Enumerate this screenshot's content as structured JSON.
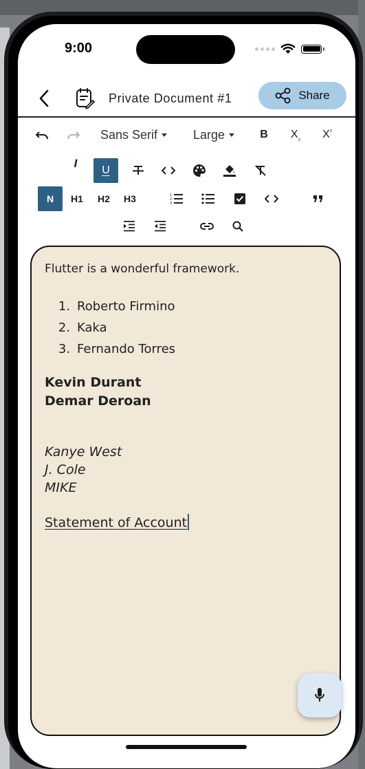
{
  "status_bar": {
    "time": "9:00"
  },
  "app_bar": {
    "title": "Private Document #1",
    "share_label": "Share"
  },
  "toolbar": {
    "font_family": "Sans Serif",
    "font_size": "Large",
    "bold": "B",
    "subscript": "X",
    "subscript_mark": "₂",
    "superscript": "X",
    "superscript_mark": "²",
    "italic": "I",
    "underline": "U",
    "heading_normal": "N",
    "heading_1": "H1",
    "heading_2": "H2",
    "heading_3": "H3",
    "active_buttons": [
      "underline",
      "normal"
    ]
  },
  "editor": {
    "paragraph": "Flutter is a wonderful framework.",
    "ordered_list": [
      {
        "num": "1.",
        "text": "Roberto Firmino"
      },
      {
        "num": "2.",
        "text": "Kaka"
      },
      {
        "num": "3.",
        "text": "Fernando Torres"
      }
    ],
    "bold_lines": [
      "Kevin Durant",
      "Demar Deroan"
    ],
    "italic_lines": [
      "Kanye West",
      "J. Cole",
      "MIKE"
    ],
    "underlined_line": "Statement of Account"
  },
  "colors": {
    "accent": "#2c6185",
    "share_button": "#a8cbe6",
    "editor_background": "#f1e8d8",
    "fab_background": "#dce9f5"
  },
  "icons": {
    "back": "chevron-left-icon",
    "document": "document-edit-icon",
    "share": "share-icon",
    "mic": "microphone-icon"
  }
}
